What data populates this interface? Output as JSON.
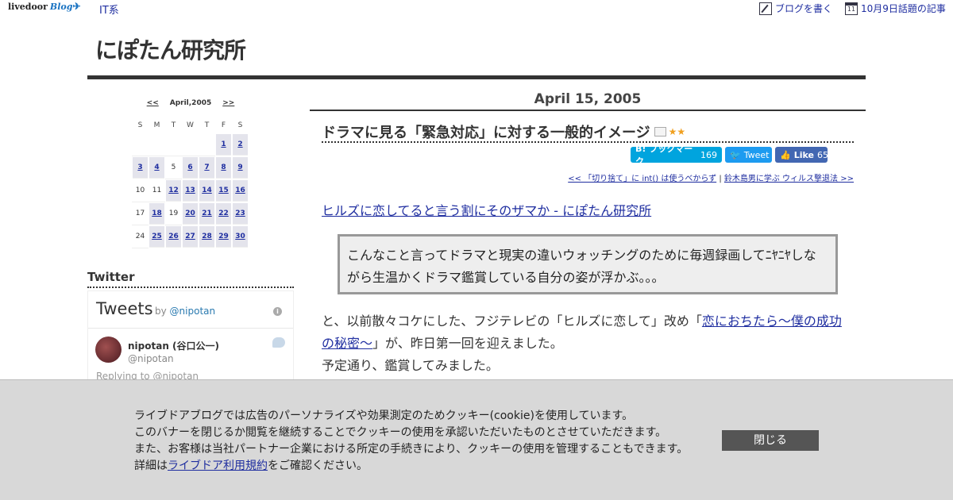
{
  "topbar": {
    "logo_text": "livedoor",
    "logo_blog": "Blog",
    "category": "IT系",
    "write_blog": "ブログを書く",
    "calendar_icon_day": "11",
    "topics": "10月9日話題の記事"
  },
  "header": {
    "site_title": "にぽたん研究所"
  },
  "calendar": {
    "prev": "<<",
    "month": "April,2005",
    "next": ">>",
    "weekdays": [
      "S",
      "M",
      "T",
      "W",
      "T",
      "F",
      "S"
    ],
    "days": [
      {
        "d": "",
        "link": false
      },
      {
        "d": "",
        "link": false
      },
      {
        "d": "",
        "link": false
      },
      {
        "d": "",
        "link": false
      },
      {
        "d": "",
        "link": false
      },
      {
        "d": "1",
        "link": true
      },
      {
        "d": "2",
        "link": true
      },
      {
        "d": "3",
        "link": true
      },
      {
        "d": "4",
        "link": true
      },
      {
        "d": "5",
        "link": false
      },
      {
        "d": "6",
        "link": true
      },
      {
        "d": "7",
        "link": true
      },
      {
        "d": "8",
        "link": true
      },
      {
        "d": "9",
        "link": true
      },
      {
        "d": "10",
        "link": false
      },
      {
        "d": "11",
        "link": false
      },
      {
        "d": "12",
        "link": true
      },
      {
        "d": "13",
        "link": true
      },
      {
        "d": "14",
        "link": true
      },
      {
        "d": "15",
        "link": true
      },
      {
        "d": "16",
        "link": true
      },
      {
        "d": "17",
        "link": false
      },
      {
        "d": "18",
        "link": true
      },
      {
        "d": "19",
        "link": false
      },
      {
        "d": "20",
        "link": true
      },
      {
        "d": "21",
        "link": true
      },
      {
        "d": "22",
        "link": true
      },
      {
        "d": "23",
        "link": true
      },
      {
        "d": "24",
        "link": false
      },
      {
        "d": "25",
        "link": true
      },
      {
        "d": "26",
        "link": true
      },
      {
        "d": "27",
        "link": true
      },
      {
        "d": "28",
        "link": true
      },
      {
        "d": "29",
        "link": true
      },
      {
        "d": "30",
        "link": true
      }
    ]
  },
  "twitter": {
    "heading": "Twitter",
    "title": "Tweets",
    "by": "by ",
    "by_handle": "@nipotan",
    "info": "i",
    "tweet_name": "nipotan (谷口公一)",
    "tweet_handle": "@nipotan",
    "replying": "Replying to @nipotan"
  },
  "post": {
    "date": "April 15, 2005",
    "title": "ドラマに見る「緊急対応」に対する一般的イメージ",
    "stars": "★★",
    "hatena_label": "B! ブックマーク",
    "hatena_count": "169",
    "tweet_label": "Tweet",
    "like_label": "Like",
    "like_count": "65",
    "prev_link": "<< 「切り捨て」に int() は使うべからず",
    "separator": " | ",
    "next_link": "鈴木島男に学ぶ ウィルス撃退法 >>",
    "ref_link": "ヒルズに恋してると言う割にそのザマか - にぽたん研究所",
    "quote": "こんなこと言ってドラマと現実の違いウォッチングのために毎週録画してﾆﾔﾆﾔしながら生温かくドラマ鑑賞している自分の姿が浮かぶ。。。",
    "body_1": "と、以前散々コケにした、フジテレビの「ヒルズに恋して」改め「",
    "body_link": "恋におちたら～僕の成功の秘密～",
    "body_2": "」が、昨日第一回を迎えました。",
    "body_3": "予定通り、鑑賞してみました。"
  },
  "cookie": {
    "line1": "ライブドアブログでは広告のパーソナライズや効果測定のためクッキー(cookie)を使用しています。",
    "line2": "このバナーを閉じるか閲覧を継続することでクッキーの使用を承認いただいたものとさせていただきます。",
    "line3": "また、お客様は当社パートナー企業における所定の手続きにより、クッキーの使用を管理することもできます。",
    "line4_pre": "詳細は",
    "line4_link": "ライブドア利用規約",
    "line4_post": "をご確認ください。",
    "close": "閉じる"
  }
}
